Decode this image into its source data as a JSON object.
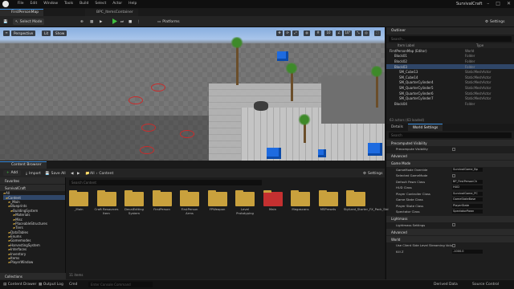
{
  "app": {
    "title": "SurvivalCraft"
  },
  "menu": [
    "File",
    "Edit",
    "Window",
    "Tools",
    "Build",
    "Select",
    "Actor",
    "Help"
  ],
  "tabs": [
    {
      "label": "FirstPersonMap",
      "active": true
    },
    {
      "label": "BPC_ItemsContainer",
      "active": false
    }
  ],
  "toolbar": {
    "select_mode": "Select Mode",
    "platforms": "Platforms",
    "settings": "Settings"
  },
  "viewport": {
    "perspective": "Perspective",
    "lit": "Lit",
    "show": "Show"
  },
  "outliner": {
    "title": "Outliner",
    "search_placeholder": "Search...",
    "col_label": "Item Label",
    "col_type": "Type",
    "rows": [
      {
        "name": "FirstPersonMap (Editor)",
        "type": "World"
      },
      {
        "name": "Block01",
        "type": "Folder"
      },
      {
        "name": "Block02",
        "type": "Folder"
      },
      {
        "name": "Block03",
        "type": "Folder"
      },
      {
        "name": "SM_Cube13",
        "type": "StaticMeshActor"
      },
      {
        "name": "SM_Cube14",
        "type": "StaticMeshActor"
      },
      {
        "name": "SM_QuarterCylinder4",
        "type": "StaticMeshActor"
      },
      {
        "name": "SM_QuarterCylinder5",
        "type": "StaticMeshActor"
      },
      {
        "name": "SM_QuarterCylinder6",
        "type": "StaticMeshActor"
      },
      {
        "name": "SM_QuarterCylinder7",
        "type": "StaticMeshActor"
      },
      {
        "name": "Block04",
        "type": "Folder"
      }
    ],
    "footer": "63 actors (63 loaded)"
  },
  "details": {
    "tab_details": "Details",
    "tab_world_settings": "World Settings",
    "search_placeholder": "Search",
    "sections": [
      {
        "title": "Precomputed Visibility",
        "props": [
          {
            "name": "Precompute Visibility",
            "value": ""
          }
        ]
      },
      {
        "title": "Advanced",
        "props": []
      },
      {
        "title": "Game Mode",
        "props": [
          {
            "name": "GameMode Override",
            "value": "SurvivalGame_Bp"
          },
          {
            "name": "Selected GameMode",
            "value": ""
          },
          {
            "name": "Default Pawn Class",
            "value": "BP_FirstPersonCh"
          },
          {
            "name": "HUD Class",
            "value": "HUD"
          },
          {
            "name": "Player Controller Class",
            "value": "SurvivalGame_PC"
          },
          {
            "name": "Game State Class",
            "value": "GameStateBase"
          },
          {
            "name": "Player State Class",
            "value": "PlayerState"
          },
          {
            "name": "Spectator Class",
            "value": "SpectatorPawn"
          }
        ]
      },
      {
        "title": "Lightmass",
        "props": [
          {
            "name": "Lightmass Settings",
            "value": ""
          }
        ]
      },
      {
        "title": "Advanced",
        "props": []
      },
      {
        "title": "World",
        "props": [
          {
            "name": "Use Client Side Level Streaming Volum...",
            "value": ""
          },
          {
            "name": "Kill Z",
            "value": "-1000.0"
          }
        ]
      }
    ]
  },
  "content_browser": {
    "title": "Content Browser",
    "add": "Add",
    "import": "Import",
    "save_all": "Save All",
    "breadcrumb_all": "All",
    "breadcrumb_content": "Content",
    "search_placeholder": "Search Content",
    "settings": "Settings",
    "favorites": "Favorites",
    "project": "SurvivalCraft",
    "tree": [
      "All",
      "Content",
      "_Main",
      "Blueprints",
      "BuildingSystem",
      "Materials",
      "Misc",
      "PlaceableStructures",
      "Tiers",
      "DataTables",
      "Enums",
      "Gamemodes",
      "HarvestingSystem",
      "Interfaces",
      "Inventory",
      "Items",
      "PlayerWindow"
    ],
    "assets": [
      {
        "label": "_Main",
        "color": "#c9a13d"
      },
      {
        "label": "Craft Resources Item",
        "color": "#c9a13d"
      },
      {
        "label": "DecalEditing System",
        "color": "#c9a13d"
      },
      {
        "label": "FirstPerson",
        "color": "#c9a13d"
      },
      {
        "label": "FirstPerson Arms",
        "color": "#c9a13d"
      },
      {
        "label": "FPWeapon",
        "color": "#c9a13d"
      },
      {
        "label": "Level Prototyping",
        "color": "#c9a13d"
      },
      {
        "label": "Main",
        "color": "#c43030"
      },
      {
        "label": "Megascans",
        "color": "#c9a13d"
      },
      {
        "label": "MSPresets",
        "color": "#c9a13d"
      },
      {
        "label": "Stylized_Starter_FX_Pack_Std",
        "color": "#c9a13d"
      }
    ],
    "count": "11 items",
    "collections": "Collections"
  },
  "statusbar": {
    "content_drawer": "Content Drawer",
    "output_log": "Output Log",
    "cmd": "Cmd",
    "cmd_placeholder": "Enter Console Command",
    "derived_data": "Derived Data",
    "source_control": "Source Control"
  }
}
